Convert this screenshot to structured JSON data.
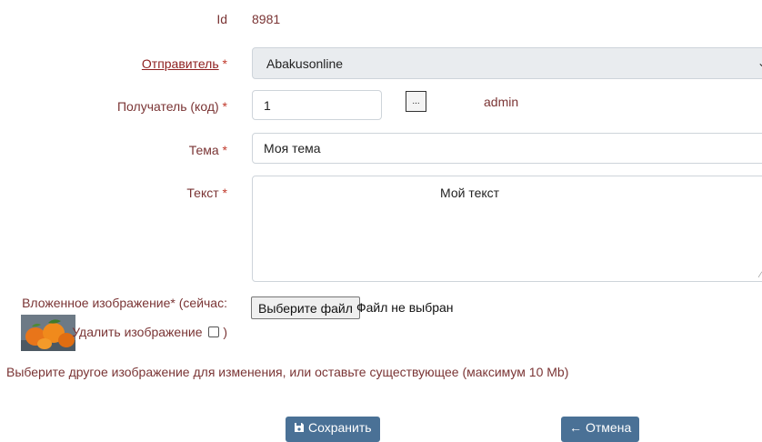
{
  "form": {
    "id_label": "Id",
    "id_value": "8981",
    "sender_label": "Отправитель",
    "sender_value": "Abakusonline",
    "recipient_label": "Получатель (код)",
    "recipient_value": "1",
    "recipient_picker": "...",
    "recipient_name": "admin",
    "subject_label": "Тема",
    "subject_value": "Моя тема",
    "text_label": "Текст",
    "text_value": "Мой текст",
    "required_mark": "*",
    "image_label": "Вложенное изображение* (сейчас:",
    "delete_image_label": "Удалить изображение",
    "delete_image_close": ")",
    "delete_image_checked": false,
    "choose_file_button": "Выберите файл",
    "file_status": "Файл не выбран",
    "hint": "Выберите другое изображение для изменения, или оставьте существующее (максимум 10 Mb)"
  },
  "actions": {
    "save_label": "Сохранить",
    "cancel_label": "Отмена"
  },
  "icons": {
    "save": "floppy-disk-icon",
    "cancel": "arrow-left-icon",
    "dropdown": "chevron-down-icon"
  },
  "colors": {
    "label_text": "#7a3434",
    "required": "#c0392b",
    "button_bg": "#4a7196"
  }
}
